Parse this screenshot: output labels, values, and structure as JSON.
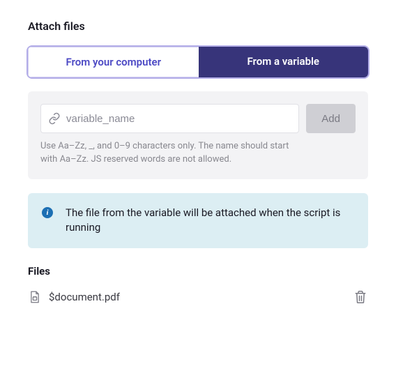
{
  "title": "Attach files",
  "tabs": {
    "computer": "From your computer",
    "variable": "From a variable"
  },
  "input": {
    "placeholder": "variable_name",
    "addLabel": "Add",
    "hint": "Use Aa–Zz, _, and 0–9 characters only. The name should start with Aa–Zz. JS reserved words are not allowed."
  },
  "info": {
    "text": "The file from the variable will be attached when the script is running"
  },
  "files": {
    "heading": "Files",
    "items": [
      {
        "name": "$document.pdf"
      }
    ]
  }
}
